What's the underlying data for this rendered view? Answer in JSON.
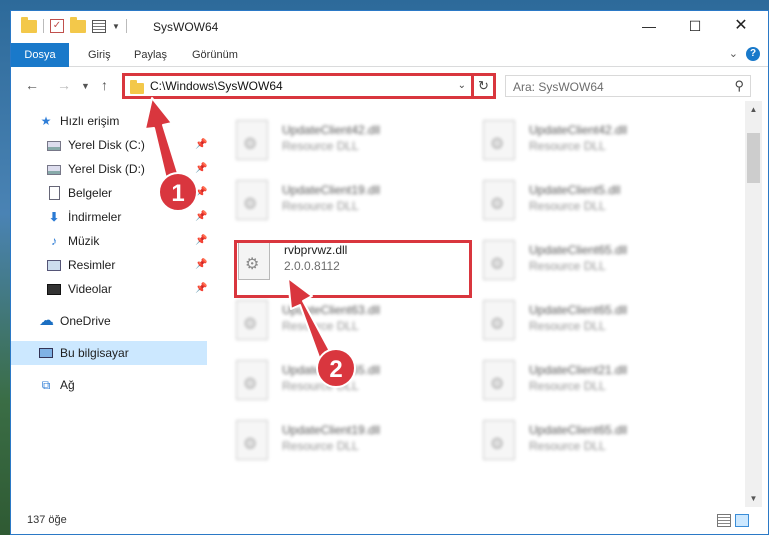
{
  "window": {
    "title": "SysWOW64"
  },
  "ribbon": {
    "tabs": [
      "Dosya",
      "Giriş",
      "Paylaş",
      "Görünüm"
    ],
    "help": "?"
  },
  "nav": {
    "address": "C:\\Windows\\SysWOW64",
    "search_placeholder": "Ara: SysWOW64"
  },
  "sidebar": {
    "items": [
      {
        "label": "Hızlı erişim"
      },
      {
        "label": "Yerel Disk (C:)"
      },
      {
        "label": "Yerel Disk (D:)"
      },
      {
        "label": "Belgeler"
      },
      {
        "label": "İndirmeler"
      },
      {
        "label": "Müzik"
      },
      {
        "label": "Resimler"
      },
      {
        "label": "Videolar"
      },
      {
        "label": "OneDrive"
      },
      {
        "label": "Bu bilgisayar"
      },
      {
        "label": "Ağ"
      }
    ]
  },
  "files": {
    "left": [
      {
        "name": "UpdateClient42.dll",
        "desc": "Resource DLL"
      },
      {
        "name": "UpdateClient19.dll",
        "desc": "Resource DLL"
      },
      {
        "name": "rvbprvwz.dll",
        "desc": "2.0.0.8112"
      },
      {
        "name": "UpdateClient63.dll",
        "desc": "Resource DLL"
      },
      {
        "name": "UpdateClient65.dll",
        "desc": "Resource DLL"
      },
      {
        "name": "UpdateClient19.dll",
        "desc": "Resource DLL"
      }
    ],
    "right": [
      {
        "name": "UpdateClient42.dll",
        "desc": "Resource DLL"
      },
      {
        "name": "UpdateClient5.dll",
        "desc": "Resource DLL"
      },
      {
        "name": "UpdateClient65.dll",
        "desc": "Resource DLL"
      },
      {
        "name": "UpdateClient65.dll",
        "desc": "Resource DLL"
      },
      {
        "name": "UpdateClient21.dll",
        "desc": "Resource DLL"
      },
      {
        "name": "UpdateClient65.dll",
        "desc": "Resource DLL"
      }
    ]
  },
  "status": {
    "count": "137 öğe"
  },
  "annotations": {
    "badge1": "1",
    "badge2": "2",
    "color": "#d9363e"
  },
  "colors": {
    "accent": "#1979ca",
    "selection": "#cce8ff"
  }
}
